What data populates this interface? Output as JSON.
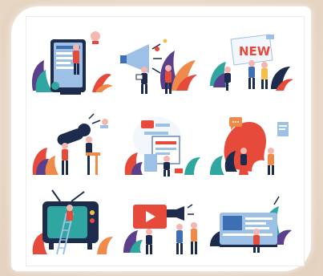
{
  "image": {
    "kind": "framed grid of flat media illustrations",
    "layout": "3x3 grid",
    "sign_text": "NEW",
    "colors": {
      "navy": "#1d2c4c",
      "red": "#e64a3b",
      "orange": "#f08a4b",
      "purple": "#5a3f8a",
      "teal": "#2fa6a0",
      "blue": "#3f6fb3",
      "light_blue": "#9cc0e6",
      "pink": "#f4b7b0",
      "yellow": "#f5c04a"
    },
    "tiles": [
      {
        "name": "phone-reading-scene",
        "icon": "smartphone-icon"
      },
      {
        "name": "megaphone-team-scene",
        "icon": "megaphone-icon"
      },
      {
        "name": "newspaper-scene",
        "icon": "newspaper-icon"
      },
      {
        "name": "microphone-interview-scene",
        "icon": "microphone-icon"
      },
      {
        "name": "press-conference-scene",
        "icon": "podium-icon"
      },
      {
        "name": "chat-head-scene",
        "icon": "chat-bubble-icon"
      },
      {
        "name": "tv-repair-scene",
        "icon": "television-icon"
      },
      {
        "name": "video-broadcast-scene",
        "icon": "video-play-icon"
      },
      {
        "name": "news-card-scene",
        "icon": "news-card-icon"
      }
    ]
  }
}
